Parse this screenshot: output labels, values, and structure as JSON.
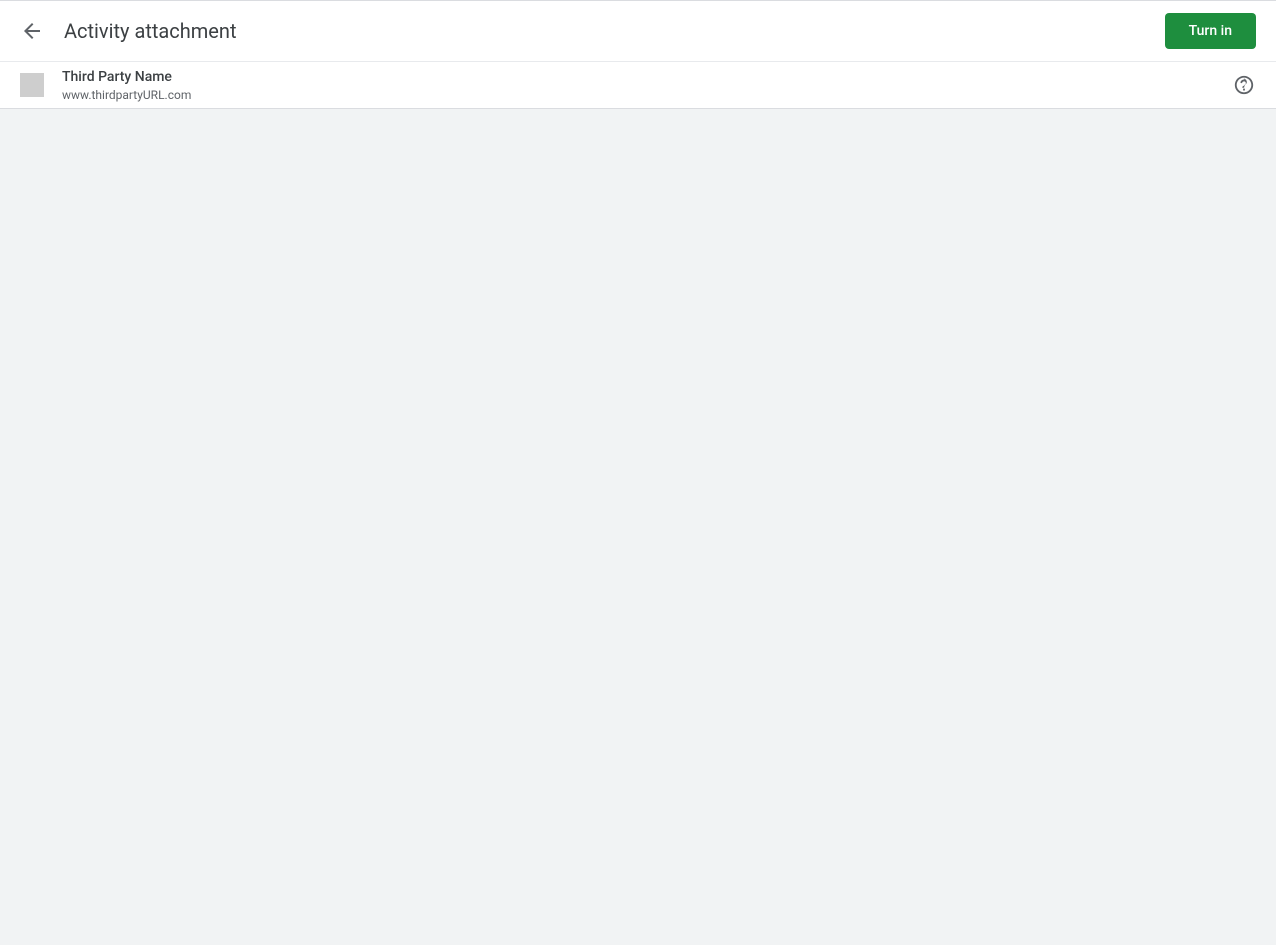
{
  "header": {
    "title": "Activity attachment",
    "turn_in_label": "Turn in"
  },
  "sub_header": {
    "app_name": "Third Party Name",
    "app_url": "www.thirdpartyURL.com"
  }
}
